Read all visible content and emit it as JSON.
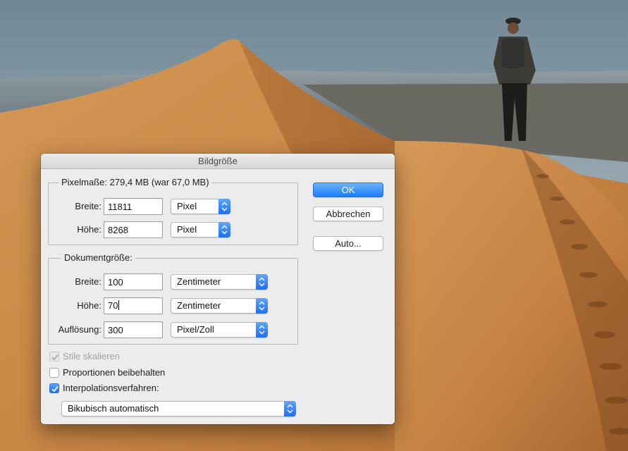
{
  "dialog": {
    "title": "Bildgröße",
    "buttons": {
      "ok": "OK",
      "cancel": "Abbrechen",
      "auto": "Auto..."
    }
  },
  "pixel_dimensions": {
    "legend": "Pixelmaße: 279,4 MB (war 67,0 MB)",
    "width": {
      "label": "Breite:",
      "value": "11811",
      "unit": "Pixel"
    },
    "height": {
      "label": "Höhe:",
      "value": "8268",
      "unit": "Pixel"
    }
  },
  "document_size": {
    "legend": "Dokumentgröße:",
    "width": {
      "label": "Breite:",
      "value": "100",
      "unit": "Zentimeter"
    },
    "height": {
      "label": "Höhe:",
      "value": "70",
      "unit": "Zentimeter"
    },
    "resolution": {
      "label": "Auflösung:",
      "value": "300",
      "unit": "Pixel/Zoll"
    }
  },
  "options": {
    "scale_styles": {
      "label": "Stile skalieren",
      "checked": true,
      "enabled": false
    },
    "constrain_proportions": {
      "label": "Proportionen beibehalten",
      "checked": false,
      "enabled": true
    },
    "resample": {
      "label": "Interpolationsverfahren:",
      "checked": true,
      "enabled": true
    },
    "resample_method": "Bikubisch automatisch"
  },
  "colors": {
    "accent": "#1c6ef4",
    "dialog_bg": "#ececec",
    "sky": "#9fb0b8",
    "sand": "#c8874a"
  }
}
